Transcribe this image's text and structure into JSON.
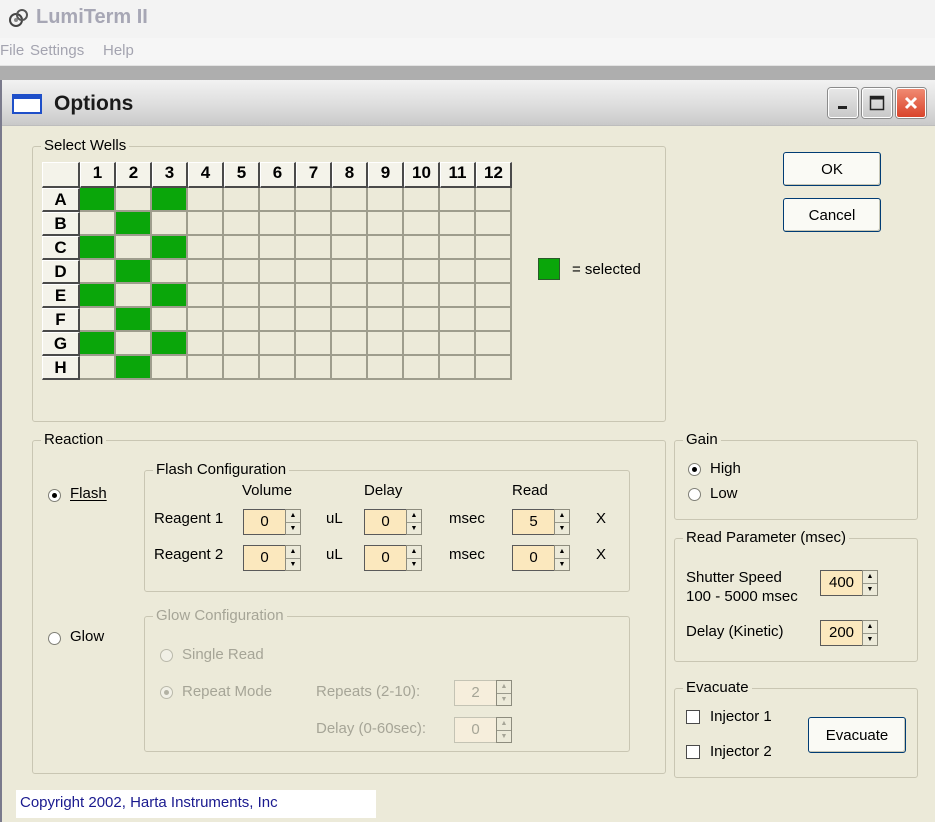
{
  "app": {
    "title": "LumiTerm II",
    "menu": [
      "File",
      "Settings",
      "Help"
    ]
  },
  "window": {
    "title": "Options"
  },
  "select_wells": {
    "label": "Select Wells",
    "columns": [
      "1",
      "2",
      "3",
      "4",
      "5",
      "6",
      "7",
      "8",
      "9",
      "10",
      "11",
      "12"
    ],
    "rows": [
      "A",
      "B",
      "C",
      "D",
      "E",
      "F",
      "G",
      "H"
    ],
    "selected": {
      "A": [
        1,
        3
      ],
      "B": [
        2
      ],
      "C": [
        1,
        3
      ],
      "D": [
        2
      ],
      "E": [
        1,
        3
      ],
      "F": [
        2
      ],
      "G": [
        1,
        3
      ],
      "H": [
        2
      ]
    },
    "legend_text": "= selected",
    "selected_color": "#0aa60a"
  },
  "buttons": {
    "ok": "OK",
    "cancel": "Cancel",
    "evacuate": "Evacuate"
  },
  "reaction": {
    "label": "Reaction",
    "flash_label": "Flash",
    "glow_label": "Glow",
    "mode": "Flash",
    "flash_config": {
      "label": "Flash Configuration",
      "headers": {
        "volume": "Volume",
        "delay": "Delay",
        "read": "Read"
      },
      "reagent1_label": "Reagent 1",
      "reagent2_label": "Reagent 2",
      "reagent1": {
        "volume": "0",
        "delay": "0",
        "read": "5"
      },
      "reagent2": {
        "volume": "0",
        "delay": "0",
        "read": "0"
      },
      "unit_volume": "uL",
      "unit_delay": "msec",
      "unit_read": "X"
    },
    "glow_config": {
      "label": "Glow Configuration",
      "single_read": "Single Read",
      "repeat_mode": "Repeat Mode",
      "repeats_label": "Repeats (2-10):",
      "repeats_value": "2",
      "delay_label": "Delay (0-60sec):",
      "delay_value": "0"
    }
  },
  "gain": {
    "label": "Gain",
    "high": "High",
    "low": "Low",
    "selected": "High"
  },
  "read_param": {
    "label": "Read Parameter (msec)",
    "shutter_label": "Shutter Speed",
    "shutter_range": "100 - 5000 msec",
    "shutter_value": "400",
    "delay_label": "Delay (Kinetic)",
    "delay_value": "200"
  },
  "evacuate": {
    "label": "Evacuate",
    "injector1": "Injector 1",
    "injector2": "Injector 2"
  },
  "copyright": "Copyright 2002, Harta Instruments, Inc"
}
